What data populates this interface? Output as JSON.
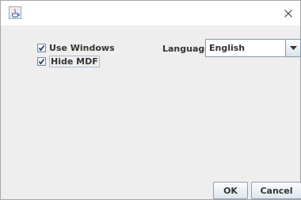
{
  "window": {
    "icon": "java-app-icon",
    "close_icon": "close-icon"
  },
  "options": {
    "use_windows": {
      "label": "Use Windows",
      "checked": true
    },
    "hide_mdf": {
      "label": "Hide MDF",
      "checked": true
    }
  },
  "language": {
    "label": "Language",
    "selected": "English"
  },
  "buttons": {
    "ok": "OK",
    "cancel": "Cancel"
  }
}
